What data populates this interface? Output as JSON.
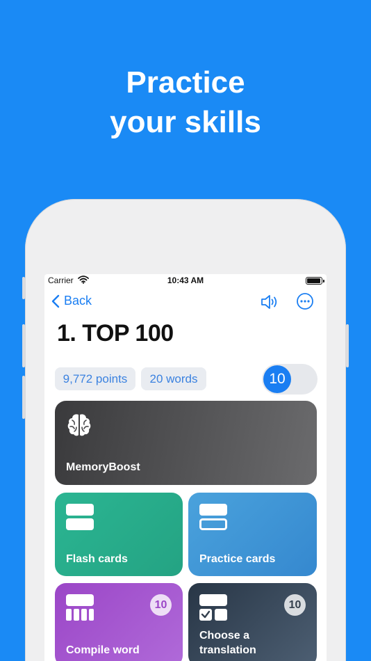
{
  "headline": {
    "line1": "Practice",
    "line2": "your skills"
  },
  "status": {
    "carrier": "Carrier",
    "time": "10:43 AM"
  },
  "nav": {
    "back_label": "Back"
  },
  "title": "1. TOP 100",
  "stats": {
    "points": "9,772 points",
    "words": "20 words"
  },
  "toggle": {
    "value": "10"
  },
  "cards": {
    "memory": {
      "label": "MemoryBoost",
      "icon": "brain-icon"
    },
    "flash": {
      "label": "Flash cards",
      "icon": "flash-cards-icon"
    },
    "practice": {
      "label": "Practice cards",
      "icon": "practice-cards-icon"
    },
    "compile": {
      "label": "Compile word",
      "badge": "10",
      "icon": "compile-word-icon"
    },
    "choose": {
      "label_line1": "Choose a",
      "label_line2": "translation",
      "badge": "10",
      "icon": "choose-translation-icon"
    }
  },
  "colors": {
    "background": "#1a8af5",
    "accent": "#1a7ef2",
    "memory": "#4a4a4c",
    "flash": "#27ad8b",
    "practice": "#4097d7",
    "compile": "#a358cf",
    "choose": "#3b4a5b"
  }
}
